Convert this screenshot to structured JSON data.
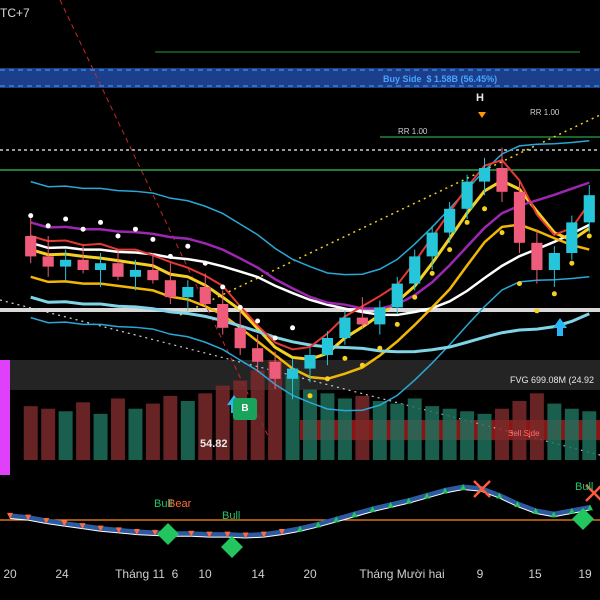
{
  "header": {
    "timezone_label": "TC+7"
  },
  "annotations": {
    "buy_side": "Buy Side",
    "buy_side_value": "$ 1.58B (56.45%)",
    "rr_label": "RR 1.00",
    "swing_high_mark": "H",
    "fvg_label": "FVG 699.08M (24.92",
    "sell_side_label": "Sell Side",
    "swing_low_label": "54.82",
    "buy_badge": "B",
    "osc_bull": "Bull",
    "osc_bear": "Bear"
  },
  "colors": {
    "background": "#000000",
    "bull_candle": "#26c6da",
    "bear_candle": "#ef5b7a",
    "buy_side_band": "#1b3f8a",
    "magenta_bar": "#e040fb",
    "ma_yellow": "#f5d020",
    "ma_white": "#ffffff",
    "ma_purple": "#9c27b0",
    "ma_red": "#e53935",
    "band_blue": "#29a8d6",
    "osc_line": "#2c5aa0",
    "osc_orange": "#ff8c1a"
  },
  "chart_data": {
    "type": "candlestick",
    "xlabel": "",
    "ylabel": "",
    "x_tick_labels": [
      "20",
      "24",
      "Tháng 11",
      "6",
      "10",
      "14",
      "20",
      "Tháng Mười hai",
      "9",
      "15",
      "19"
    ],
    "candles": [
      {
        "o": 60,
        "h": 66,
        "l": 52,
        "c": 54
      },
      {
        "o": 54,
        "h": 60,
        "l": 48,
        "c": 51
      },
      {
        "o": 51,
        "h": 56,
        "l": 47,
        "c": 53
      },
      {
        "o": 53,
        "h": 57,
        "l": 49,
        "c": 50
      },
      {
        "o": 50,
        "h": 55,
        "l": 45,
        "c": 52
      },
      {
        "o": 52,
        "h": 56,
        "l": 47,
        "c": 48
      },
      {
        "o": 48,
        "h": 53,
        "l": 44,
        "c": 50
      },
      {
        "o": 50,
        "h": 55,
        "l": 46,
        "c": 47
      },
      {
        "o": 47,
        "h": 52,
        "l": 40,
        "c": 42
      },
      {
        "o": 42,
        "h": 47,
        "l": 38,
        "c": 45
      },
      {
        "o": 45,
        "h": 49,
        "l": 39,
        "c": 40
      },
      {
        "o": 40,
        "h": 44,
        "l": 31,
        "c": 33
      },
      {
        "o": 33,
        "h": 38,
        "l": 25,
        "c": 27
      },
      {
        "o": 27,
        "h": 31,
        "l": 20,
        "c": 23
      },
      {
        "o": 23,
        "h": 26,
        "l": 15,
        "c": 18
      },
      {
        "o": 18,
        "h": 24,
        "l": 12,
        "c": 21
      },
      {
        "o": 21,
        "h": 27,
        "l": 17,
        "c": 25
      },
      {
        "o": 25,
        "h": 32,
        "l": 22,
        "c": 30
      },
      {
        "o": 30,
        "h": 38,
        "l": 28,
        "c": 36
      },
      {
        "o": 36,
        "h": 42,
        "l": 33,
        "c": 34
      },
      {
        "o": 34,
        "h": 41,
        "l": 31,
        "c": 39
      },
      {
        "o": 39,
        "h": 48,
        "l": 37,
        "c": 46
      },
      {
        "o": 46,
        "h": 56,
        "l": 44,
        "c": 54
      },
      {
        "o": 54,
        "h": 63,
        "l": 50,
        "c": 61
      },
      {
        "o": 61,
        "h": 70,
        "l": 58,
        "c": 68
      },
      {
        "o": 68,
        "h": 78,
        "l": 65,
        "c": 76
      },
      {
        "o": 76,
        "h": 83,
        "l": 72,
        "c": 80
      },
      {
        "o": 80,
        "h": 86,
        "l": 70,
        "c": 73
      },
      {
        "o": 73,
        "h": 76,
        "l": 55,
        "c": 58
      },
      {
        "o": 58,
        "h": 62,
        "l": 46,
        "c": 50
      },
      {
        "o": 50,
        "h": 57,
        "l": 45,
        "c": 55
      },
      {
        "o": 55,
        "h": 66,
        "l": 53,
        "c": 64
      },
      {
        "o": 64,
        "h": 75,
        "l": 61,
        "c": 72
      }
    ],
    "volume": [
      42,
      40,
      38,
      45,
      36,
      48,
      40,
      44,
      50,
      46,
      52,
      58,
      62,
      70,
      78,
      66,
      55,
      52,
      48,
      50,
      46,
      44,
      48,
      42,
      40,
      38,
      36,
      40,
      46,
      52,
      44,
      40,
      38
    ],
    "oscillator": [
      46,
      44,
      40,
      37,
      34,
      31,
      29,
      27,
      26,
      25,
      25,
      24,
      24,
      23,
      24,
      27,
      31,
      36,
      42,
      48,
      54,
      59,
      64,
      70,
      76,
      80,
      78,
      70,
      60,
      52,
      48,
      52,
      56
    ],
    "oscillator_ylim": [
      0,
      100
    ],
    "price_ylim": [
      0,
      100
    ]
  }
}
